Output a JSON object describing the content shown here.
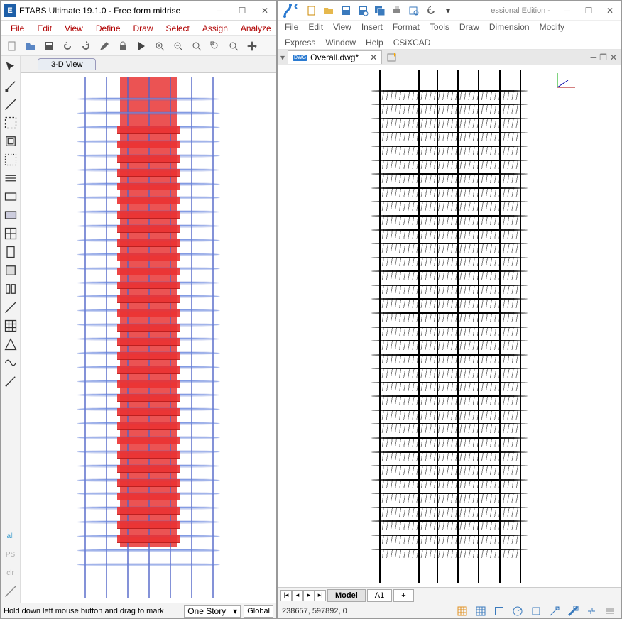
{
  "left": {
    "app_icon_letter": "E",
    "title": "ETABS Ultimate 19.1.0 - Free form midrise",
    "menu": [
      "File",
      "Edit",
      "View",
      "Define",
      "Draw",
      "Select",
      "Assign",
      "Analyze"
    ],
    "view_tab": "3-D View",
    "status_hint": "Hold down left mouse button and drag to mark",
    "story_sel": "One Story",
    "coord_sel": "Global"
  },
  "right": {
    "title_suffix": "essional Edition -",
    "menu_row1": [
      "File",
      "Edit",
      "View",
      "Insert",
      "Format",
      "Tools",
      "Draw",
      "Dimension",
      "Modify"
    ],
    "menu_row2": [
      "Express",
      "Window",
      "Help",
      "CSiXCAD"
    ],
    "doc_name": "Overall.dwg*",
    "sheet_active": "Model",
    "sheet_a1": "A1",
    "sheet_add": "+",
    "coords": "238657, 597892, 0"
  }
}
